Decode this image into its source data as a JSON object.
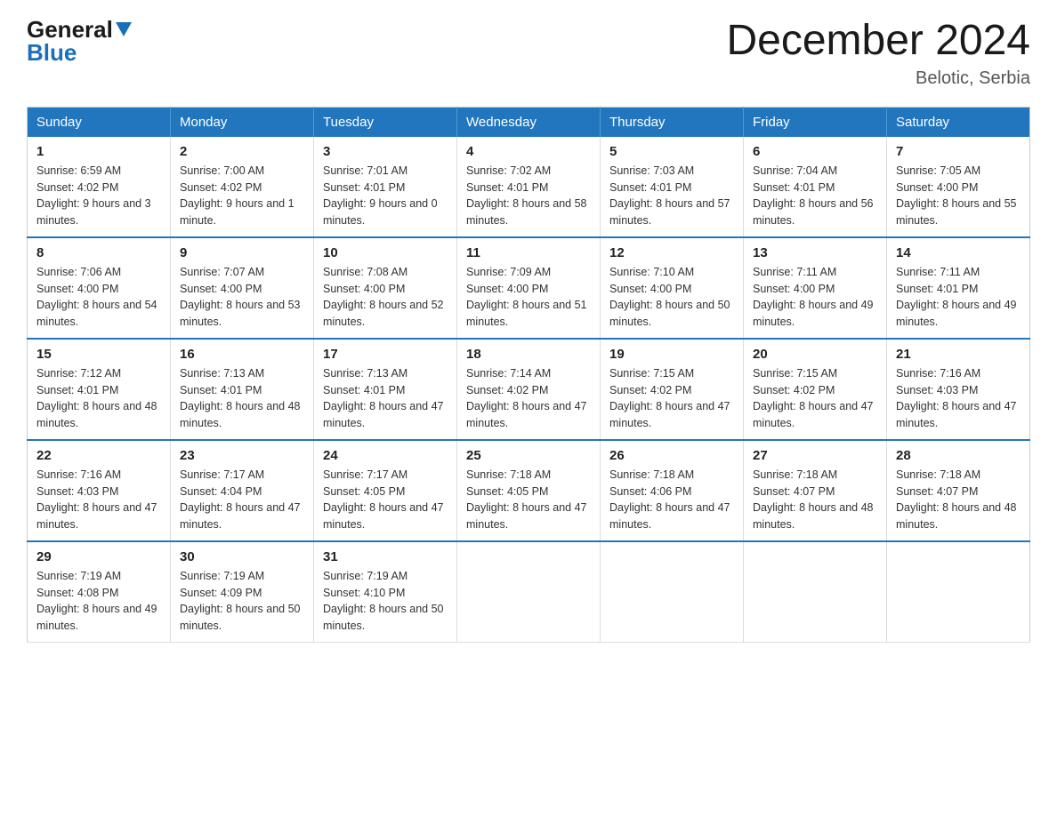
{
  "header": {
    "logo_general": "General",
    "logo_blue": "Blue",
    "title": "December 2024",
    "subtitle": "Belotic, Serbia"
  },
  "calendar": {
    "days_of_week": [
      "Sunday",
      "Monday",
      "Tuesday",
      "Wednesday",
      "Thursday",
      "Friday",
      "Saturday"
    ],
    "weeks": [
      [
        {
          "date": "1",
          "sunrise": "6:59 AM",
          "sunset": "4:02 PM",
          "daylight": "9 hours and 3 minutes."
        },
        {
          "date": "2",
          "sunrise": "7:00 AM",
          "sunset": "4:02 PM",
          "daylight": "9 hours and 1 minute."
        },
        {
          "date": "3",
          "sunrise": "7:01 AM",
          "sunset": "4:01 PM",
          "daylight": "9 hours and 0 minutes."
        },
        {
          "date": "4",
          "sunrise": "7:02 AM",
          "sunset": "4:01 PM",
          "daylight": "8 hours and 58 minutes."
        },
        {
          "date": "5",
          "sunrise": "7:03 AM",
          "sunset": "4:01 PM",
          "daylight": "8 hours and 57 minutes."
        },
        {
          "date": "6",
          "sunrise": "7:04 AM",
          "sunset": "4:01 PM",
          "daylight": "8 hours and 56 minutes."
        },
        {
          "date": "7",
          "sunrise": "7:05 AM",
          "sunset": "4:00 PM",
          "daylight": "8 hours and 55 minutes."
        }
      ],
      [
        {
          "date": "8",
          "sunrise": "7:06 AM",
          "sunset": "4:00 PM",
          "daylight": "8 hours and 54 minutes."
        },
        {
          "date": "9",
          "sunrise": "7:07 AM",
          "sunset": "4:00 PM",
          "daylight": "8 hours and 53 minutes."
        },
        {
          "date": "10",
          "sunrise": "7:08 AM",
          "sunset": "4:00 PM",
          "daylight": "8 hours and 52 minutes."
        },
        {
          "date": "11",
          "sunrise": "7:09 AM",
          "sunset": "4:00 PM",
          "daylight": "8 hours and 51 minutes."
        },
        {
          "date": "12",
          "sunrise": "7:10 AM",
          "sunset": "4:00 PM",
          "daylight": "8 hours and 50 minutes."
        },
        {
          "date": "13",
          "sunrise": "7:11 AM",
          "sunset": "4:00 PM",
          "daylight": "8 hours and 49 minutes."
        },
        {
          "date": "14",
          "sunrise": "7:11 AM",
          "sunset": "4:01 PM",
          "daylight": "8 hours and 49 minutes."
        }
      ],
      [
        {
          "date": "15",
          "sunrise": "7:12 AM",
          "sunset": "4:01 PM",
          "daylight": "8 hours and 48 minutes."
        },
        {
          "date": "16",
          "sunrise": "7:13 AM",
          "sunset": "4:01 PM",
          "daylight": "8 hours and 48 minutes."
        },
        {
          "date": "17",
          "sunrise": "7:13 AM",
          "sunset": "4:01 PM",
          "daylight": "8 hours and 47 minutes."
        },
        {
          "date": "18",
          "sunrise": "7:14 AM",
          "sunset": "4:02 PM",
          "daylight": "8 hours and 47 minutes."
        },
        {
          "date": "19",
          "sunrise": "7:15 AM",
          "sunset": "4:02 PM",
          "daylight": "8 hours and 47 minutes."
        },
        {
          "date": "20",
          "sunrise": "7:15 AM",
          "sunset": "4:02 PM",
          "daylight": "8 hours and 47 minutes."
        },
        {
          "date": "21",
          "sunrise": "7:16 AM",
          "sunset": "4:03 PM",
          "daylight": "8 hours and 47 minutes."
        }
      ],
      [
        {
          "date": "22",
          "sunrise": "7:16 AM",
          "sunset": "4:03 PM",
          "daylight": "8 hours and 47 minutes."
        },
        {
          "date": "23",
          "sunrise": "7:17 AM",
          "sunset": "4:04 PM",
          "daylight": "8 hours and 47 minutes."
        },
        {
          "date": "24",
          "sunrise": "7:17 AM",
          "sunset": "4:05 PM",
          "daylight": "8 hours and 47 minutes."
        },
        {
          "date": "25",
          "sunrise": "7:18 AM",
          "sunset": "4:05 PM",
          "daylight": "8 hours and 47 minutes."
        },
        {
          "date": "26",
          "sunrise": "7:18 AM",
          "sunset": "4:06 PM",
          "daylight": "8 hours and 47 minutes."
        },
        {
          "date": "27",
          "sunrise": "7:18 AM",
          "sunset": "4:07 PM",
          "daylight": "8 hours and 48 minutes."
        },
        {
          "date": "28",
          "sunrise": "7:18 AM",
          "sunset": "4:07 PM",
          "daylight": "8 hours and 48 minutes."
        }
      ],
      [
        {
          "date": "29",
          "sunrise": "7:19 AM",
          "sunset": "4:08 PM",
          "daylight": "8 hours and 49 minutes."
        },
        {
          "date": "30",
          "sunrise": "7:19 AM",
          "sunset": "4:09 PM",
          "daylight": "8 hours and 50 minutes."
        },
        {
          "date": "31",
          "sunrise": "7:19 AM",
          "sunset": "4:10 PM",
          "daylight": "8 hours and 50 minutes."
        },
        null,
        null,
        null,
        null
      ]
    ]
  }
}
